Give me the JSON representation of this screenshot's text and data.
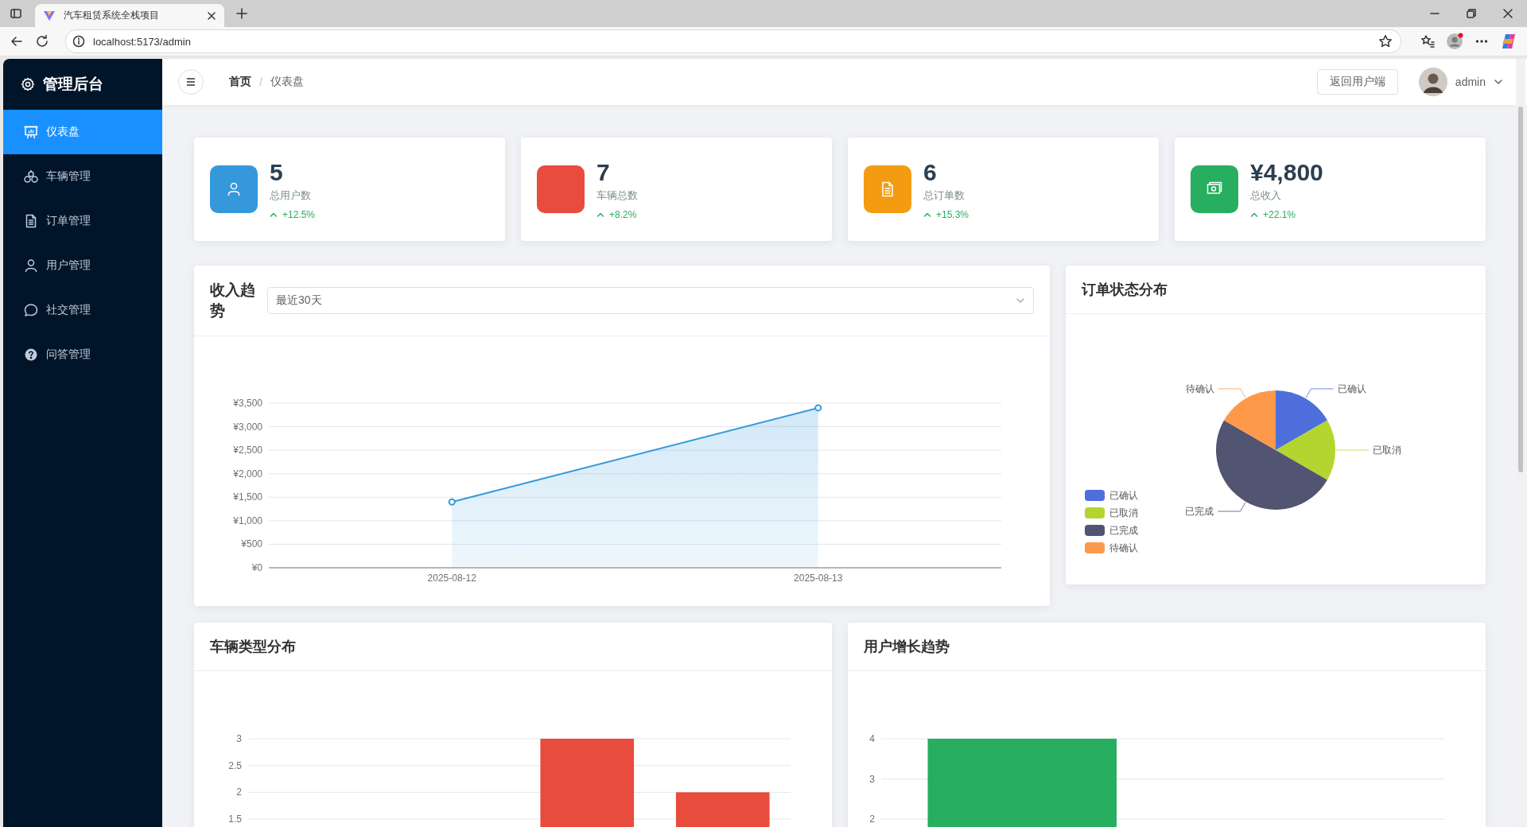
{
  "browser": {
    "tab_title": "汽车租赁系统全栈项目",
    "url": "localhost:5173/admin"
  },
  "sidebar": {
    "title": "管理后台",
    "items": [
      {
        "label": "仪表盘",
        "selected": true
      },
      {
        "label": "车辆管理",
        "selected": false
      },
      {
        "label": "订单管理",
        "selected": false
      },
      {
        "label": "用户管理",
        "selected": false
      },
      {
        "label": "社交管理",
        "selected": false
      },
      {
        "label": "问答管理",
        "selected": false
      }
    ]
  },
  "header": {
    "breadcrumbs": [
      "首页",
      "仪表盘"
    ],
    "separator": "/",
    "return_button": "返回用户端",
    "user": "admin"
  },
  "stats": [
    {
      "value": "5",
      "label": "总用户数",
      "trend": "+12.5%",
      "color": "#3498db"
    },
    {
      "value": "7",
      "label": "车辆总数",
      "trend": "+8.2%",
      "color": "#e74c3c"
    },
    {
      "value": "6",
      "label": "总订单数",
      "trend": "+15.3%",
      "color": "#f39c12"
    },
    {
      "value": "¥4,800",
      "label": "总收入",
      "trend": "+22.1%",
      "color": "#27ae60"
    }
  ],
  "income": {
    "title": "收入趋势",
    "range_select": {
      "value": "最近30天"
    },
    "chart_data": {
      "type": "area",
      "categories": [
        "2025-08-12",
        "2025-08-13"
      ],
      "series": [
        {
          "color": "#3498db",
          "values": [
            1400,
            3400
          ]
        }
      ],
      "ylim": [
        0,
        3500
      ],
      "grid": true,
      "yticks": [
        {
          "value": 0,
          "label": "¥0"
        },
        {
          "value": 500,
          "label": "¥500"
        },
        {
          "value": 1000,
          "label": "¥1,000"
        },
        {
          "value": 1500,
          "label": "¥1,500"
        },
        {
          "value": 2000,
          "label": "¥2,000"
        },
        {
          "value": 2500,
          "label": "¥2,500"
        },
        {
          "value": 3000,
          "label": "¥3,000"
        },
        {
          "value": 3500,
          "label": "¥3,500"
        }
      ]
    }
  },
  "order_status": {
    "title": "订单状态分布",
    "chart_data": {
      "type": "pie",
      "categories": [
        "已确认",
        "已取消",
        "已完成",
        "待确认"
      ],
      "values": [
        16.67,
        16.67,
        50,
        16.66
      ],
      "legend": true,
      "colors": [
        "#4e6fdb",
        "#b4d52f",
        "#525571",
        "#fd994b"
      ]
    }
  },
  "vehicle_types": {
    "title": "车辆类型分布",
    "chart_data": {
      "type": "bar",
      "series": [
        {
          "color": "#e74c3c",
          "values": [
            null,
            null,
            3,
            2
          ]
        }
      ],
      "ylim": [
        0,
        3
      ],
      "grid": true,
      "yticks": [
        1.5,
        2,
        2.5,
        3
      ]
    }
  },
  "user_growth": {
    "title": "用户增长趋势",
    "chart_data": {
      "type": "bar",
      "series": [
        {
          "color": "#27ae60",
          "values": [
            4,
            null
          ]
        }
      ],
      "ylim": [
        0,
        4
      ],
      "grid": true,
      "yticks": [
        2,
        3,
        4
      ]
    }
  }
}
